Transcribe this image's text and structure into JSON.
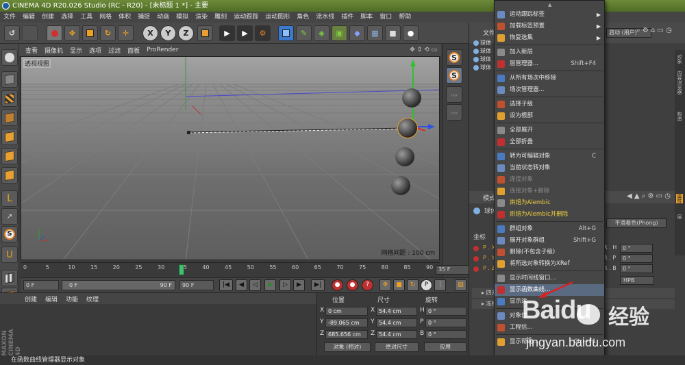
{
  "window": {
    "title": "CINEMA 4D R20.026 Studio (RC - R20) - [未标题 1 *] - 主要"
  },
  "menubar": [
    "文件",
    "编辑",
    "创建",
    "选择",
    "工具",
    "网格",
    "体积",
    "捕捉",
    "动画",
    "模拟",
    "渲染",
    "雕刻",
    "运动跟踪",
    "运动图形",
    "角色",
    "流水线",
    "插件",
    "脚本",
    "窗口",
    "帮助"
  ],
  "maintoolbar": {
    "undo": "↺",
    "axes": [
      "X",
      "Y",
      "Z"
    ]
  },
  "viewport": {
    "menu": [
      "查看",
      "摄像机",
      "显示",
      "选项",
      "过滤",
      "面板",
      "ProRender"
    ],
    "label": "透视视图",
    "grid_spacing": "网格间距 : 100 cm"
  },
  "timeline": {
    "ticks": [
      "0",
      "5",
      "10",
      "15",
      "20",
      "25",
      "30",
      "35",
      "40",
      "45",
      "50",
      "55",
      "60",
      "65",
      "70",
      "75",
      "80",
      "85",
      "90"
    ],
    "current_frame": "35 F",
    "current": 35,
    "end": 90
  },
  "frameslider": {
    "start": "0 F",
    "slider_start": "0 F",
    "slider_end": "90 F",
    "end": "90 F"
  },
  "material_panel": {
    "tabs": [
      "创建",
      "编辑",
      "功能",
      "纹理"
    ],
    "logo": "MAXON CINEMA 4D"
  },
  "coords": {
    "headers": [
      "位置",
      "尺寸",
      "旋转"
    ],
    "rows": [
      {
        "axis": "X",
        "pos": "0 cm",
        "size_axis": "X",
        "size": "54.4 cm",
        "rot_axis": "H",
        "rot": "0 °"
      },
      {
        "axis": "Y",
        "pos": "-89.065 cm",
        "size_axis": "Y",
        "size": "54.4 cm",
        "rot_axis": "P",
        "rot": "0 °"
      },
      {
        "axis": "Z",
        "pos": "685.656 cm",
        "size_axis": "Z",
        "size": "54.4 cm",
        "rot_axis": "B",
        "rot": "0 °"
      }
    ],
    "mode": "对象 (相对)",
    "size_mode": "绝对尺寸",
    "apply": "应用"
  },
  "statusbar": {
    "text": "在函数曲线管理器显示对象"
  },
  "right_panel": {
    "layout_label": "启动 (用户)",
    "object_tab": "文件",
    "objects": [
      "球体",
      "球体",
      "球体",
      "球体"
    ],
    "attr_tab": "模式",
    "attr_object": "球体",
    "attr_label": "坐标",
    "shading": "平滑着色(Phong)",
    "rot_order": "HPB",
    "rows": [
      {
        "l": "P . X",
        "r": "R . H",
        "v": "0 °"
      },
      {
        "l": "P . Y",
        "r": "R . P",
        "v": "0 °"
      },
      {
        "l": "P . Z",
        "r": "R . B",
        "v": "0 °"
      }
    ],
    "groups": [
      "四元",
      "冻结"
    ],
    "side_tabs": [
      "对象",
      "内容浏览器",
      "构造",
      "属性",
      "层"
    ]
  },
  "context_menu": {
    "items": [
      {
        "label": "运动跟踪标签",
        "arrow": true,
        "sep_after": false
      },
      {
        "label": "加载标签预置",
        "arrow": true,
        "sep_after": false
      },
      {
        "label": "恢复选集",
        "arrow": true,
        "sep_after": true
      },
      {
        "label": "加入新层",
        "sep_after": false
      },
      {
        "label": "层管理器...",
        "shortcut": "Shift+F4",
        "sep_after": true
      },
      {
        "label": "从所有场次中移除",
        "sep_after": false
      },
      {
        "label": "场次管理器...",
        "sep_after": true
      },
      {
        "label": "选择子级",
        "sep_after": false
      },
      {
        "label": "设为根部",
        "sep_after": true
      },
      {
        "label": "全部展开",
        "sep_after": false
      },
      {
        "label": "全部折叠",
        "sep_after": true
      },
      {
        "label": "转为可编辑对象",
        "shortcut": "C",
        "sep_after": false
      },
      {
        "label": "当前状态转对象",
        "sep_after": false
      },
      {
        "label": "连接对象",
        "disabled": true,
        "sep_after": false
      },
      {
        "label": "连接对象+删除",
        "disabled": true,
        "sep_after": false
      },
      {
        "label": "烘焙为Alembic",
        "yellow": true,
        "sep_after": false
      },
      {
        "label": "烘焙为Alembic并删除",
        "yellow": true,
        "sep_after": true
      },
      {
        "label": "群组对象",
        "shortcut": "Alt+G",
        "sep_after": false
      },
      {
        "label": "展开对象群组",
        "shortcut": "Shift+G",
        "sep_after": false
      },
      {
        "label": "删除(不包含子级)",
        "sep_after": false
      },
      {
        "label": "将所选对象转换为XRef",
        "sep_after": true
      },
      {
        "label": "显示时间线窗口...",
        "sep_after": false
      },
      {
        "label": "显示函数曲线...",
        "highlight": true,
        "sep_after": false
      },
      {
        "label": "显示运...",
        "sep_after": true
      },
      {
        "label": "对象信...",
        "sep_after": false
      },
      {
        "label": "工程信...",
        "sep_after": true
      },
      {
        "label": "显示帮助...",
        "shortcut": "Ctrl+F1",
        "sep_after": false
      }
    ]
  },
  "watermark": {
    "brand": "Baidu",
    "brand_cn": "经验",
    "url": "jingyan.baidu.com"
  }
}
